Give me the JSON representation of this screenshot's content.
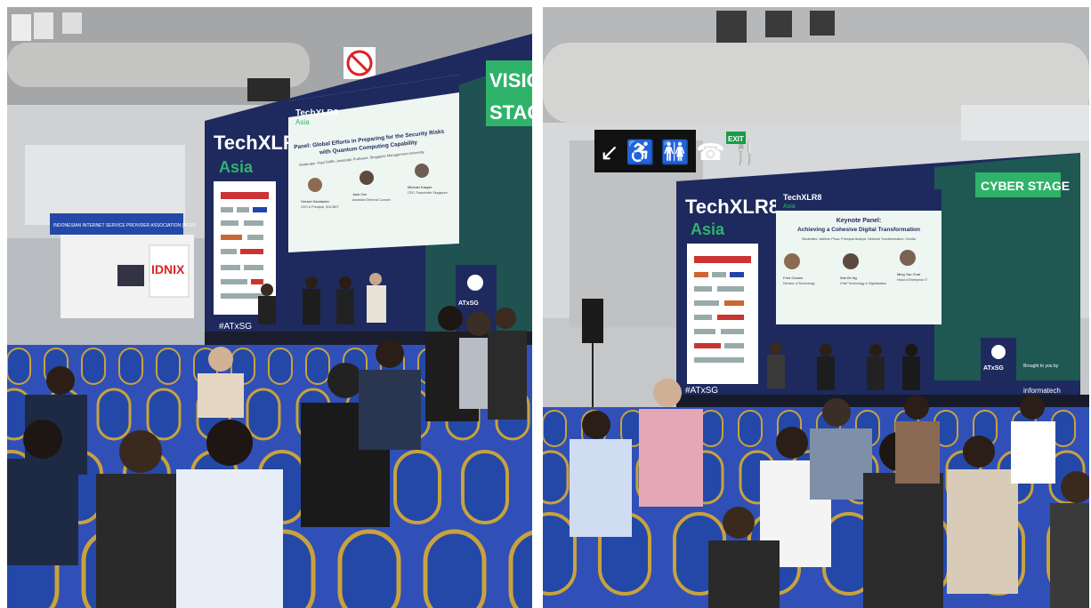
{
  "left_photo": {
    "stage_name_line1": "VISIO",
    "stage_name_line2": "STAG",
    "event_title": "TechXLR8",
    "event_region": "Asia",
    "hashtag": "#ATxSG",
    "screen": {
      "header": "TechXLR8",
      "header_sub": "Asia",
      "panel_title_line1": "Panel: Global Efforts in Preparing for the Security Risks",
      "panel_title_line2": "with Quantum Computing Capability",
      "moderator": "Moderator: Paul Griffin, Associate Professor, Singapore Management University",
      "speakers": [
        {
          "name": "Gerard Sandanter",
          "role": "CEO & Principal, SOCNET"
        },
        {
          "name": "Jack Ore",
          "role": "Assistant General Counsel"
        },
        {
          "name": "Michael Kasper",
          "role": "CEO, Fraunhofer Singapore"
        }
      ]
    },
    "booth_sign": "INDONESIAN INTERNET SERVICE PROVIDER ASSOCIATION (APJII)",
    "booth_logo": "IDNIX",
    "podium_logo": "ATxSG"
  },
  "right_photo": {
    "stage_name": "CYBER STAGE",
    "event_title": "TechXLR8",
    "event_region": "Asia",
    "hashtag": "#ATxSG",
    "exit_sign": "EXIT",
    "screen": {
      "header": "TechXLR8",
      "header_sub": "Asia",
      "panel_title_line1": "Keynote Panel:",
      "panel_title_line2": "Achieving a Cohesive Digital Transformation",
      "moderator": "Moderator: Adeline Phua, Principal Analyst, Network Transformation, Omdia",
      "speakers": [
        {
          "name": "Fred Gomes",
          "role": "Director of Technology"
        },
        {
          "name": "Wai Kit Ng",
          "role": "Chief Technology & Digitalisation"
        },
        {
          "name": "Ming Yao Chai",
          "role": "Head of Enterprise IT"
        }
      ]
    },
    "podium_logo": "ATxSG",
    "sponsor_label": "Brought to you by",
    "sponsor_logo": "informatech"
  },
  "colors": {
    "stage_navy": "#1e2a5e",
    "stage_green": "#2fb36b",
    "chair_blue": "#2448a8",
    "chair_gold": "#c9a23c",
    "carpet_blue": "#3050b8",
    "ceiling_grey": "#c8c8c8"
  }
}
